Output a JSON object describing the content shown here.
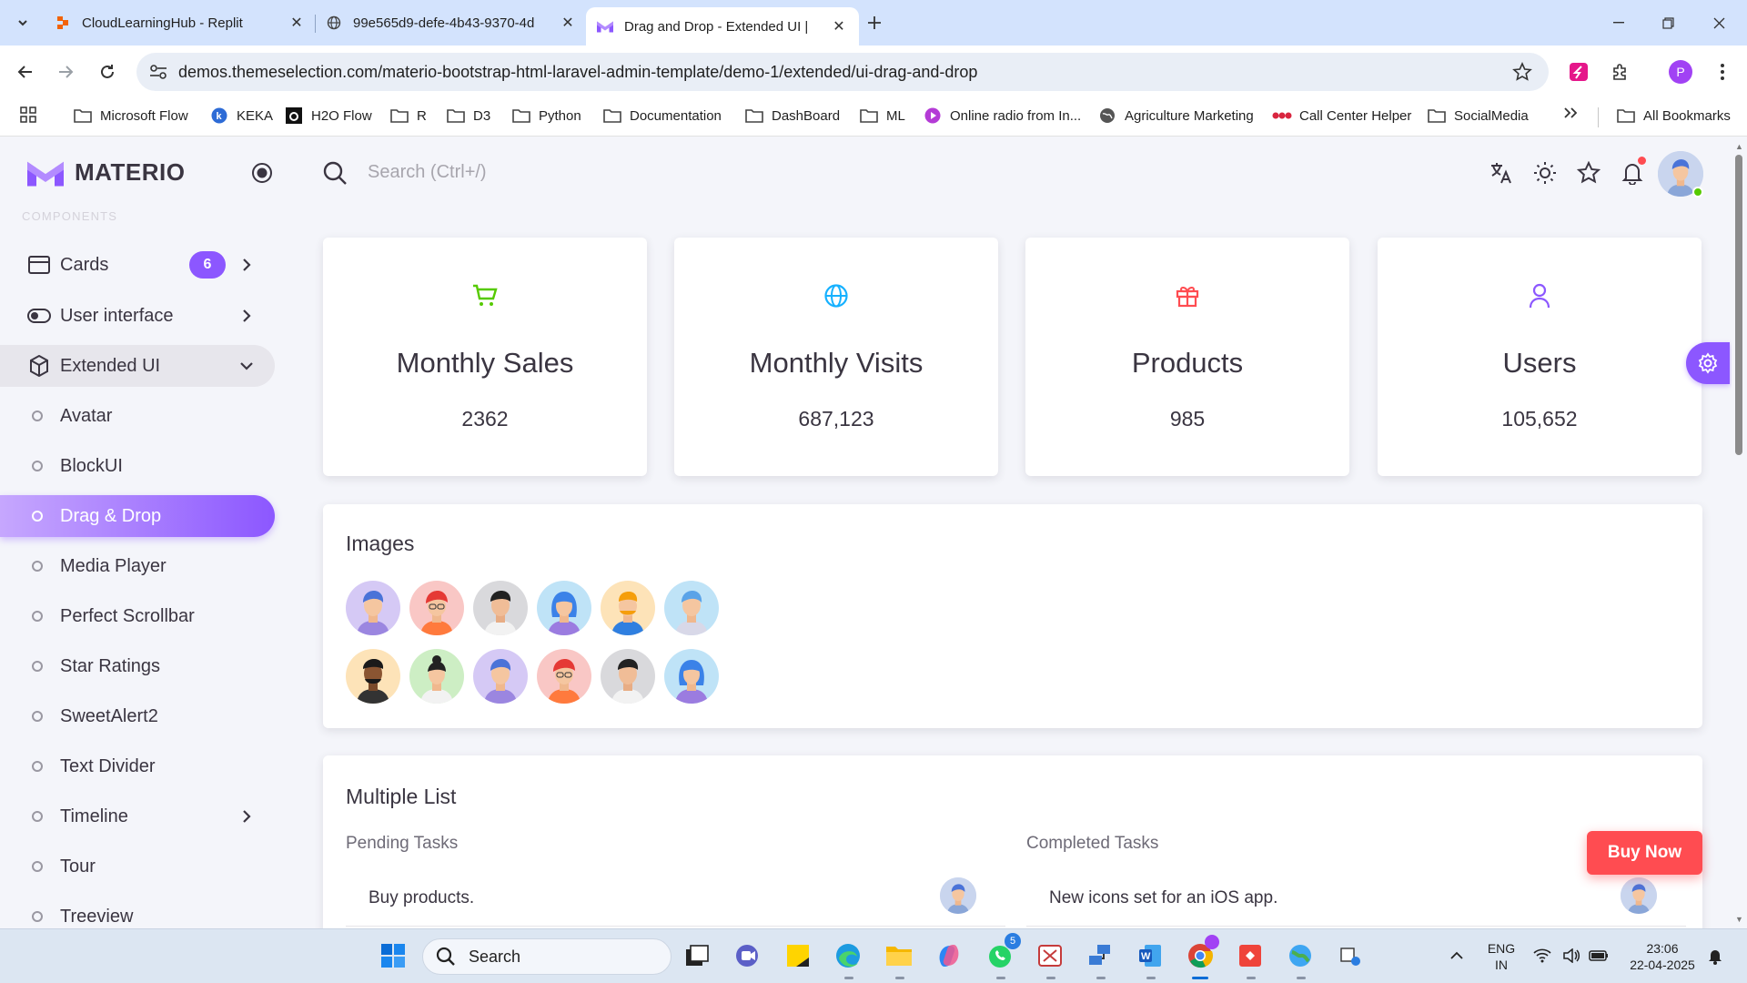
{
  "browser": {
    "tabs": [
      {
        "title": "CloudLearningHub - Replit",
        "active": false
      },
      {
        "title": "99e565d9-defe-4b43-9370-4d",
        "active": false
      },
      {
        "title": "Drag and Drop - Extended UI | ",
        "active": true
      }
    ],
    "url": "demos.themeselection.com/materio-bootstrap-html-laravel-admin-template/demo-1/extended/ui-drag-and-drop",
    "profile_initial": "P",
    "bookmarks": [
      "Microsoft Flow",
      "KEKA",
      "H2O Flow",
      "R",
      "D3",
      "Python",
      "Documentation",
      "DashBoard",
      "ML",
      "Online radio from In...",
      "Agriculture Marketing",
      "Call Center Helper",
      "SocialMedia"
    ],
    "all_bookmarks": "All Bookmarks"
  },
  "sidebar": {
    "brand": "MATERIO",
    "section_label": "COMPONENTS",
    "cards": {
      "label": "Cards",
      "badge": "6"
    },
    "user_interface": "User interface",
    "extended_ui": "Extended UI",
    "sub_items": [
      "Avatar",
      "BlockUI",
      "Drag & Drop",
      "Media Player",
      "Perfect Scrollbar",
      "Star Ratings",
      "SweetAlert2",
      "Text Divider",
      "Timeline",
      "Tour",
      "Treeview"
    ],
    "active_item": "Drag & Drop"
  },
  "topnav": {
    "search_placeholder": "Search (Ctrl+/)"
  },
  "stats": [
    {
      "title": "Monthly Sales",
      "value": "2362",
      "icon": "cart-icon",
      "color": "#56ca00"
    },
    {
      "title": "Monthly Visits",
      "value": "687,123",
      "icon": "globe-icon",
      "color": "#16b1ff"
    },
    {
      "title": "Products",
      "value": "985",
      "icon": "gift-icon",
      "color": "#ff4c51"
    },
    {
      "title": "Users",
      "value": "105,652",
      "icon": "user-icon",
      "color": "#8c57ff"
    }
  ],
  "images_card": {
    "title": "Images"
  },
  "multiple_list": {
    "title": "Multiple List",
    "pending_header": "Pending Tasks",
    "completed_header": "Completed Tasks",
    "pending_first": "Buy products.",
    "completed_first": "New icons set for an iOS app."
  },
  "buy_now": "Buy Now",
  "taskbar": {
    "search": "Search",
    "lang_top": "ENG",
    "lang_bottom": "IN",
    "time": "23:06",
    "date": "22-04-2025",
    "whatsapp_badge": "5"
  },
  "colors": {
    "primary": "#8c57ff",
    "danger": "#ff4c51",
    "success": "#56ca00",
    "info": "#16b1ff"
  }
}
